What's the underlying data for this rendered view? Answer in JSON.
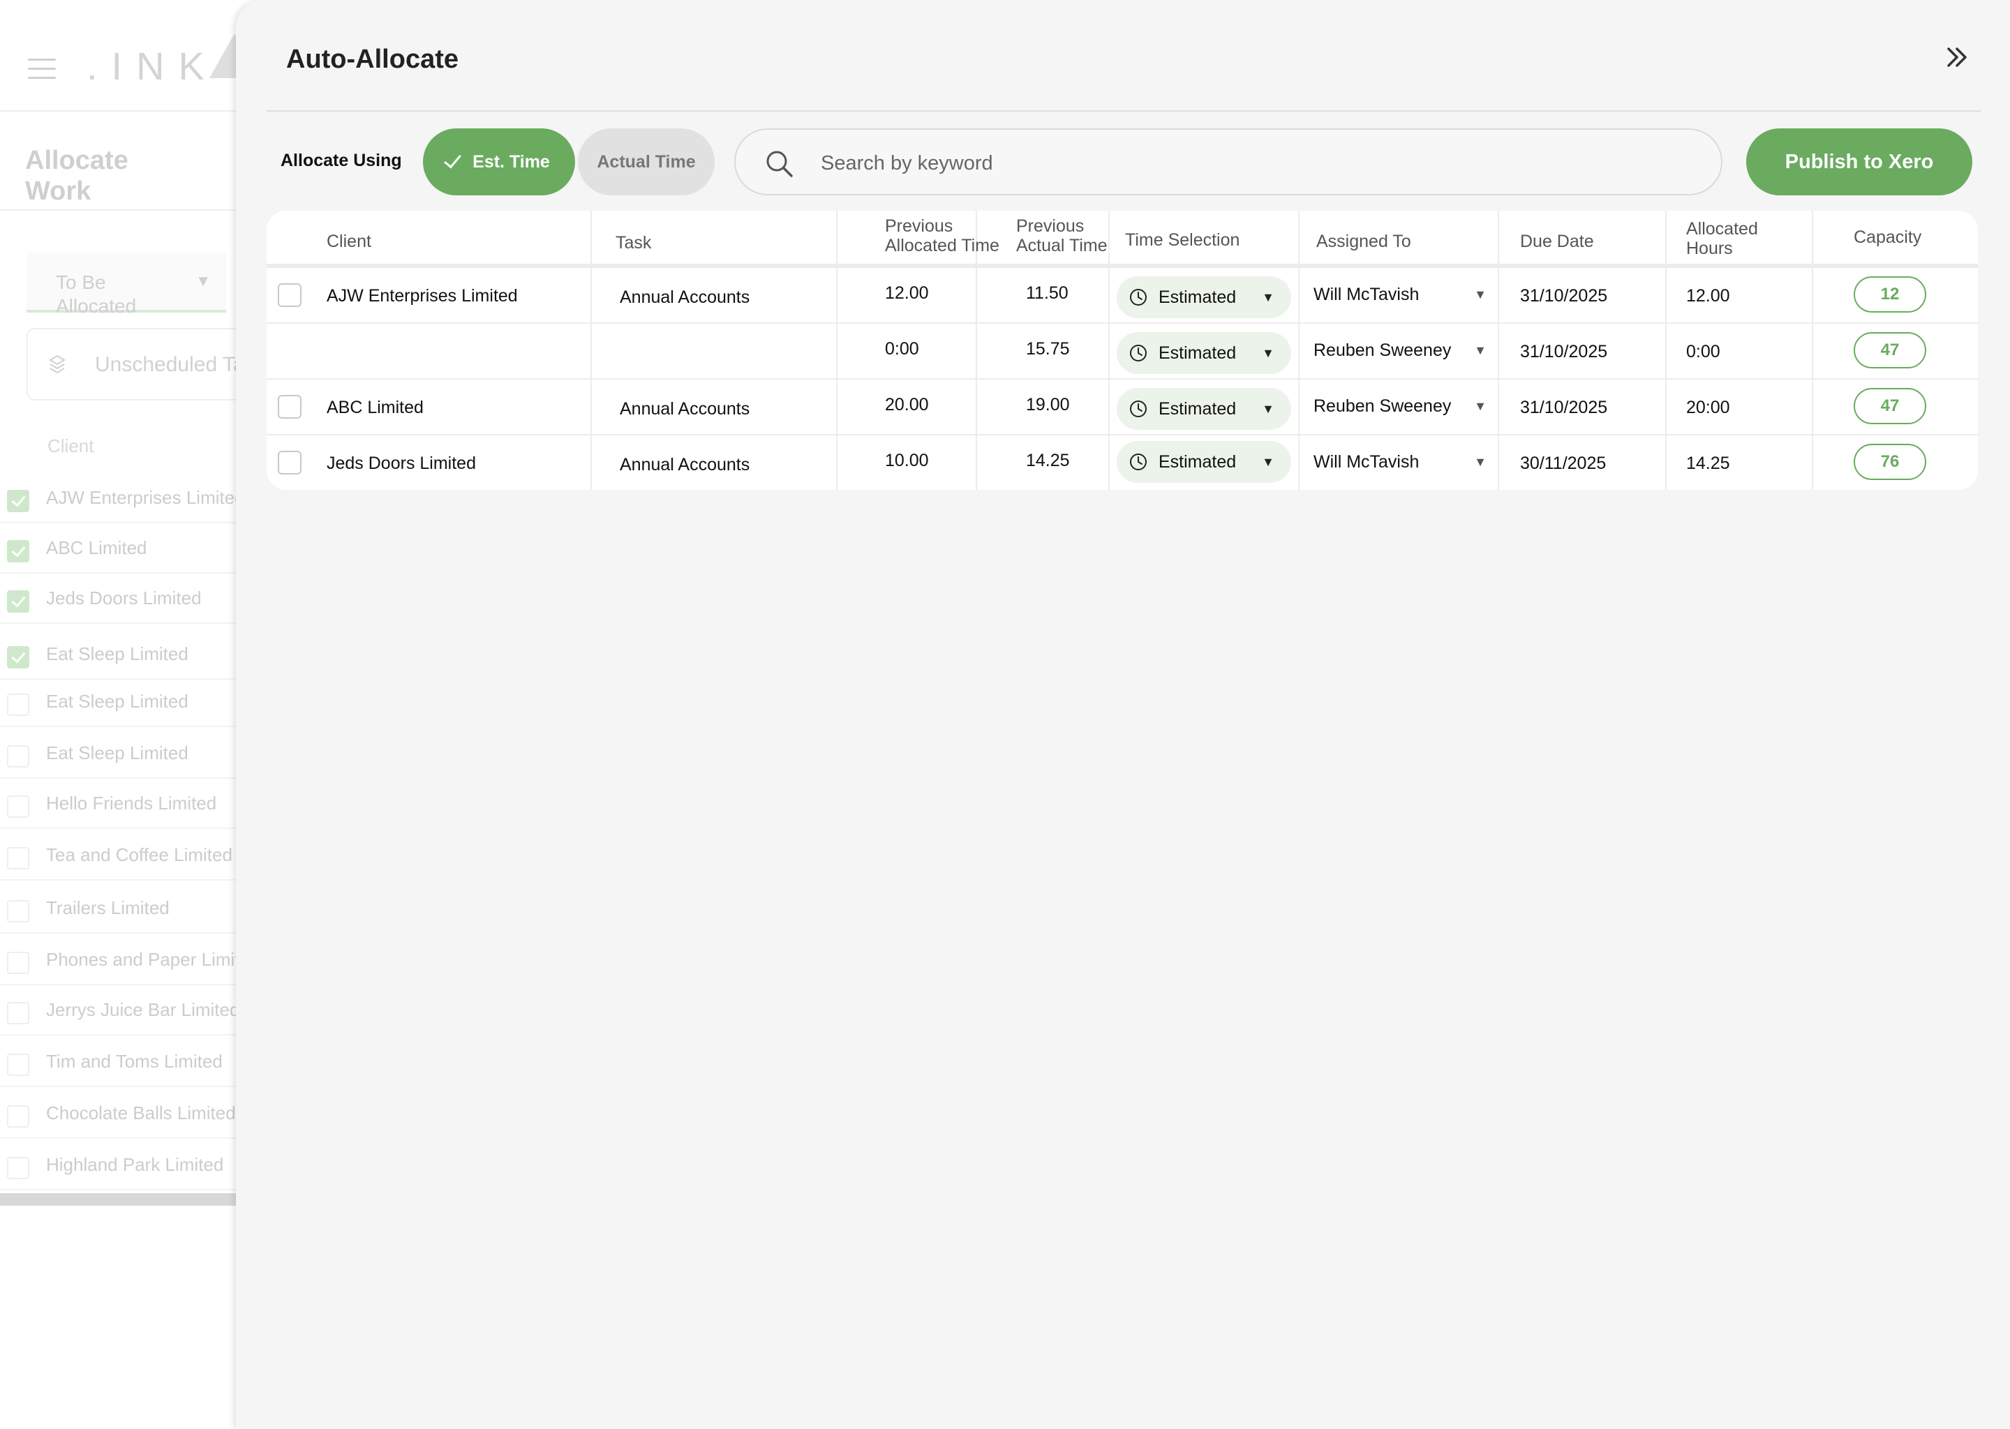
{
  "background": {
    "logo_text": ".INK",
    "title": "Allocate Work",
    "status_select": "To Be Allocated",
    "search_text": "Unscheduled Ta",
    "client_header": "Client",
    "clients": [
      {
        "name": "AJW Enterprises Limited",
        "checked": true
      },
      {
        "name": "ABC Limited",
        "checked": true
      },
      {
        "name": "Jeds Doors Limited",
        "checked": true
      },
      {
        "name": "Eat Sleep Limited",
        "checked": true
      },
      {
        "name": "Eat Sleep Limited",
        "checked": false
      },
      {
        "name": "Eat Sleep Limited",
        "checked": false
      },
      {
        "name": "Hello Friends Limited",
        "checked": false
      },
      {
        "name": "Tea and Coffee Limited",
        "checked": false
      },
      {
        "name": "Trailers Limited",
        "checked": false
      },
      {
        "name": "Phones and Paper Limit",
        "checked": false
      },
      {
        "name": "Jerrys Juice Bar Limited",
        "checked": false
      },
      {
        "name": "Tim and Toms Limited",
        "checked": false
      },
      {
        "name": "Chocolate Balls Limited",
        "checked": false
      },
      {
        "name": "Highland Park Limited",
        "checked": false
      }
    ]
  },
  "drawer": {
    "title": "Auto-Allocate",
    "collapse_icon": "double-chevron-right-icon",
    "allocate_using_label": "Allocate Using",
    "est_time_label": "Est. Time",
    "actual_time_label": "Actual Time",
    "selected_mode": "Est. Time",
    "search_placeholder": "Search by keyword",
    "publish_label": "Publish to Xero",
    "accent_color": "#6aab5f"
  },
  "table": {
    "headers": {
      "client": "Client",
      "task": "Task",
      "prev_alloc_1": "Previous",
      "prev_alloc_2": "Allocated Time",
      "prev_actual_1": "Previous",
      "prev_actual_2": "Actual Time",
      "time_selection": "Time Selection",
      "assigned_to": "Assigned To",
      "due_date": "Due Date",
      "allocated_hours_1": "Allocated",
      "allocated_hours_2": "Hours",
      "capacity": "Capacity"
    },
    "rows": [
      {
        "client": "AJW Enterprises Limited",
        "task": "Annual Accounts",
        "prev_alloc": "12.00",
        "prev_actual": "11.50",
        "time_selection": "Estimated",
        "assigned_to": "Will McTavish",
        "due_date": "31/10/2025",
        "allocated_hours": "12.00",
        "capacity": "12",
        "has_checkbox": true
      },
      {
        "client": "",
        "task": "",
        "prev_alloc": "0:00",
        "prev_actual": "15.75",
        "time_selection": "Estimated",
        "assigned_to": "Reuben Sweeney",
        "due_date": "31/10/2025",
        "allocated_hours": "0:00",
        "capacity": "47",
        "has_checkbox": false
      },
      {
        "client": "ABC Limited",
        "task": "Annual Accounts",
        "prev_alloc": "20.00",
        "prev_actual": "19.00",
        "time_selection": "Estimated",
        "assigned_to": "Reuben Sweeney",
        "due_date": "31/10/2025",
        "allocated_hours": "20:00",
        "capacity": "47",
        "has_checkbox": true
      },
      {
        "client": "Jeds Doors Limited",
        "task": "Annual Accounts",
        "prev_alloc": "10.00",
        "prev_actual": "14.25",
        "time_selection": "Estimated",
        "assigned_to": "Will McTavish",
        "due_date": "30/11/2025",
        "allocated_hours": "14.25",
        "capacity": "76",
        "has_checkbox": true
      }
    ]
  }
}
